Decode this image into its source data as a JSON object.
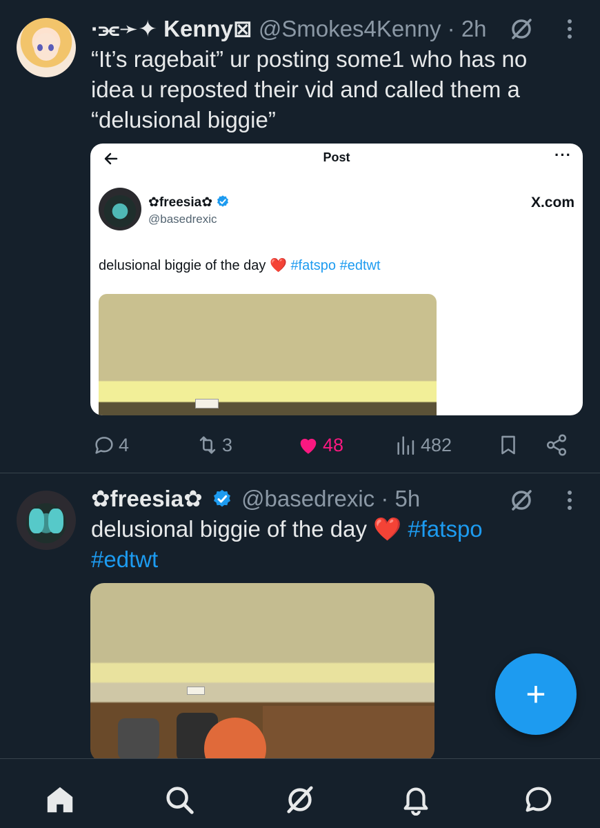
{
  "tweet1": {
    "name": "·⫘➛✦ Kenny⊠",
    "handle": "@Smokes4Kenny",
    "separator": "·",
    "time": "2h",
    "text": "“It’s ragebait” ur posting some1 who has no idea u reposted their vid and called them a “delusional biggie”",
    "quoted_screenshot": {
      "back_icon": "arrow-left-icon",
      "title": "Post",
      "more": "···",
      "name": "✿freesia✿",
      "handle": "@basedrexic",
      "source": "X.com",
      "text": "delusional biggie of the day",
      "heart": "❤️",
      "hashtags": [
        "#fatspo",
        "#edtwt"
      ]
    },
    "actions": {
      "replies": "4",
      "retweets": "3",
      "likes": "48",
      "views": "482"
    }
  },
  "tweet2": {
    "name": "✿freesia✿",
    "handle": "@basedrexic",
    "separator": "·",
    "time": "5h",
    "text": "delusional biggie of the day",
    "heart": "❤️",
    "hashtag1": "#fatspo",
    "hashtag2": "#edtwt"
  },
  "fab": {
    "label": "+"
  },
  "nav": [
    "home-icon",
    "search-icon",
    "grok-icon",
    "notifications-icon",
    "messages-icon"
  ],
  "colors": {
    "background": "#15202b",
    "accent": "#1d9bf0",
    "like": "#f91880",
    "muted": "#8b98a5",
    "text": "#e7e9ea"
  }
}
